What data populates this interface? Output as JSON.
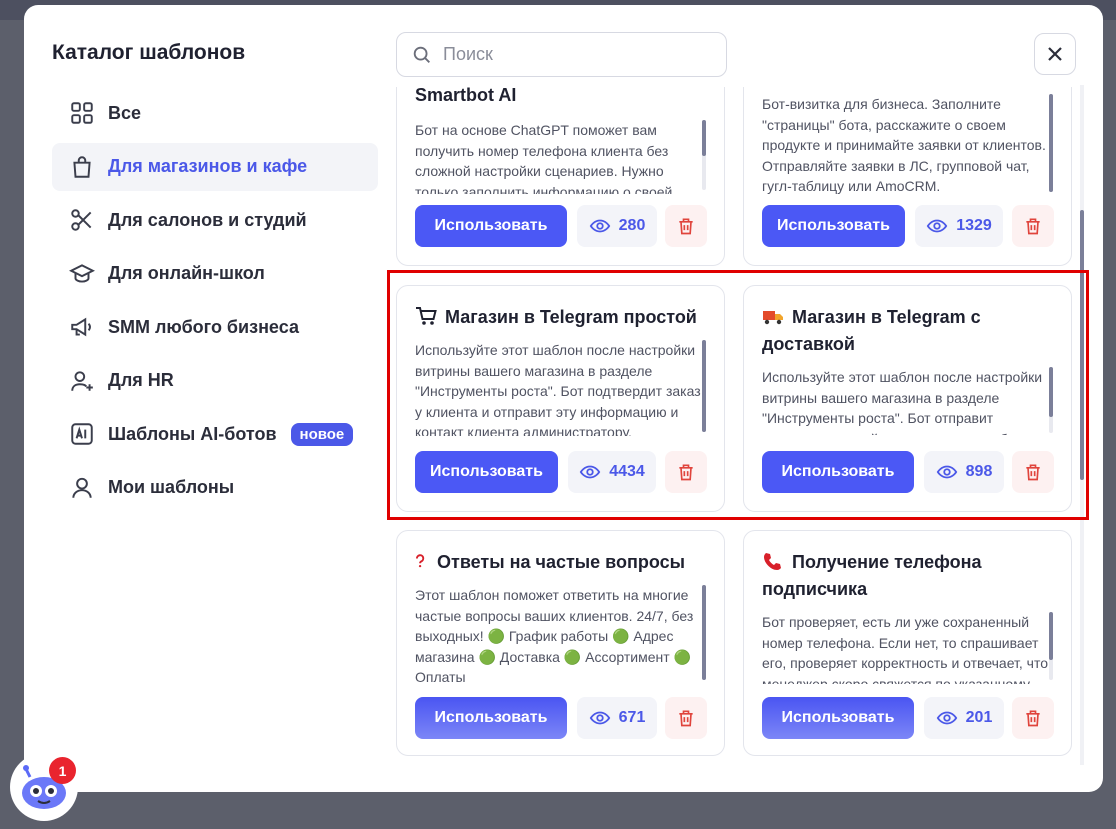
{
  "modal": {
    "title": "Каталог шаблонов"
  },
  "search": {
    "placeholder": "Поиск"
  },
  "sidebar": {
    "items": [
      {
        "label": "Все",
        "icon": "grid-icon",
        "active": false
      },
      {
        "label": "Для магазинов и кафе",
        "icon": "shopping-bag-icon",
        "active": true
      },
      {
        "label": "Для салонов и студий",
        "icon": "scissors-icon",
        "active": false
      },
      {
        "label": "Для онлайн-школ",
        "icon": "graduation-cap-icon",
        "active": false
      },
      {
        "label": "SMM любого бизнеса",
        "icon": "megaphone-icon",
        "active": false
      },
      {
        "label": "Для HR",
        "icon": "user-add-icon",
        "active": false
      },
      {
        "label": "Шаблоны AI-ботов",
        "icon": "ai-icon",
        "active": false,
        "badge": "новое"
      },
      {
        "label": "Мои шаблоны",
        "icon": "user-icon",
        "active": false
      }
    ]
  },
  "cards": [
    {
      "title": "Smartbot AI",
      "description": "Бот на основе ChatGPT поможет вам получить номер телефона клиента без сложной настройки сценариев. Нужно только заполнить информацию о своей",
      "button": "Использовать",
      "views": "280"
    },
    {
      "title": "",
      "description": "Бот-визитка для бизнеса. Заполните \"страницы\" бота, расскажите о своем продукте и принимайте заявки от клиентов. Отправляйте заявки в ЛС, групповой чат, гугл-таблицу или AmoCRM.",
      "button": "Использовать",
      "views": "1329"
    },
    {
      "title": "Магазин в Telegram простой",
      "emoji": "cart-icon",
      "description": "Используйте этот шаблон после настройки витрины вашего магазина в разделе \"Инструменты роста\". Бот подтвердит заказ у клиента и отправит эту информацию и контакт клиента администратору.",
      "button": "Использовать",
      "views": "4434"
    },
    {
      "title": "Магазин в Telegram с доставкой",
      "emoji": "truck-icon",
      "description": "Используйте этот шаблон после настройки витрины вашего магазина в разделе \"Инструменты роста\". Бот отправит предварительный заказ админу и соберет",
      "button": "Использовать",
      "views": "898"
    },
    {
      "title": "Ответы на частые вопросы",
      "emoji": "question-icon",
      "description": "Этот шаблон поможет ответить на многие частые вопросы ваших клиентов. 24/7, без выходных! 🟢 График работы 🟢 Адрес магазина 🟢 Доставка 🟢 Ассортимент 🟢 Оплаты",
      "button": "Использовать",
      "views": "671"
    },
    {
      "title": "Получение телефона подписчика",
      "emoji": "phone-icon",
      "description": "Бот проверяет, есть ли уже сохраненный номер телефона. Если нет, то спрашивает его, проверяет корректность и отвечает, что менеджер скоро свяжется по указанному",
      "button": "Использовать",
      "views": "201"
    }
  ],
  "notification": {
    "count": "1"
  },
  "colors": {
    "accent": "#4b58f5",
    "highlight": "#e00000",
    "danger": "#e0443c"
  }
}
